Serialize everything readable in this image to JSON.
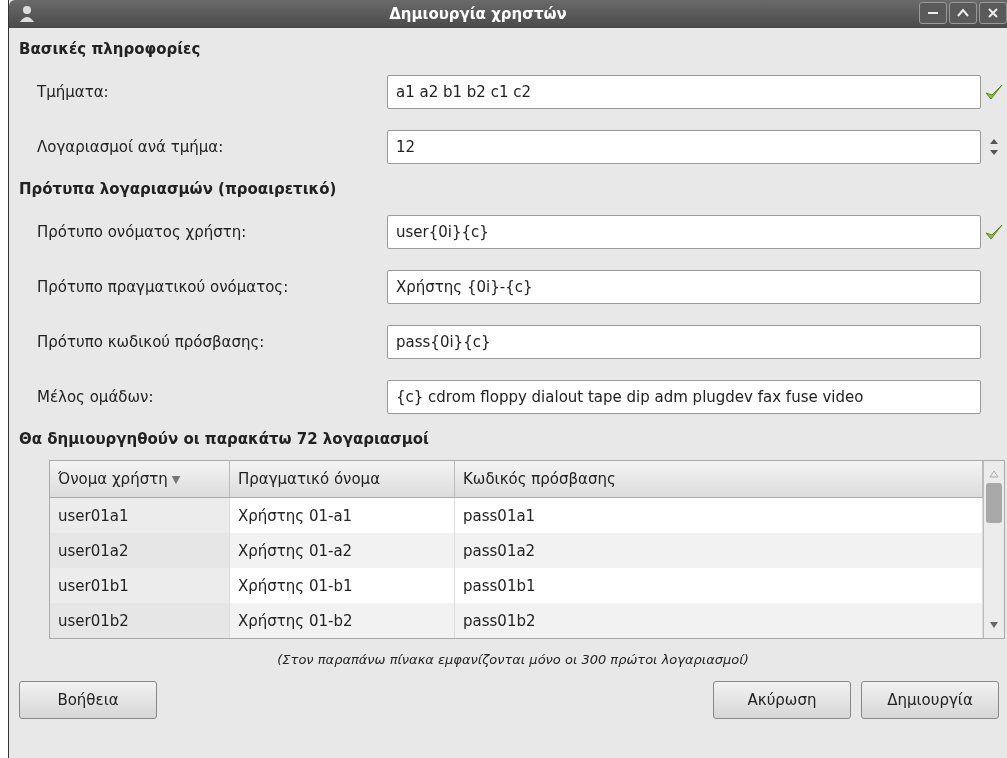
{
  "window": {
    "title": "Δημιουργία χρηστών"
  },
  "sections": [
    {
      "heading": "Βασικές πληροφορίες",
      "fields": [
        {
          "kind": "text",
          "label": "Τμήματα:",
          "value": "a1 a2 b1 b2 c1 c2",
          "valid": true
        },
        {
          "kind": "spin",
          "label": "Λογαριασμοί ανά τμήμα:",
          "value": "12"
        }
      ]
    },
    {
      "heading": "Πρότυπα λογαριασμών (προαιρετικό)",
      "fields": [
        {
          "kind": "text",
          "label": "Πρότυπο ονόματος χρήστη:",
          "value": "user{0i}{c}",
          "valid": true
        },
        {
          "kind": "text",
          "label": "Πρότυπο πραγματικού ονόματος:",
          "value": "Χρήστης {0i}-{c}",
          "valid": false
        },
        {
          "kind": "text",
          "label": "Πρότυπο κωδικού πρόσβασης:",
          "value": "pass{0i}{c}",
          "valid": false
        },
        {
          "kind": "text",
          "label": "Μέλος ομάδων:",
          "value": "{c} cdrom floppy dialout tape dip adm plugdev fax fuse video",
          "valid": false
        }
      ]
    }
  ],
  "table_heading": "Θα δημιουργηθούν οι παρακάτω 72 λογαριασμοί",
  "table": {
    "columns": [
      {
        "label": "Όνομα χρήστη",
        "sorted": true
      },
      {
        "label": "Πραγματικό όνομα",
        "sorted": false
      },
      {
        "label": "Κωδικός πρόσβασης",
        "sorted": false
      }
    ],
    "sort_indicator": "▼",
    "rows": [
      [
        "user01a1",
        "Χρήστης 01-a1",
        "pass01a1"
      ],
      [
        "user01a2",
        "Χρήστης 01-a2",
        "pass01a2"
      ],
      [
        "user01b1",
        "Χρήστης 01-b1",
        "pass01b1"
      ],
      [
        "user01b2",
        "Χρήστης 01-b2",
        "pass01b2"
      ]
    ]
  },
  "note": "(Στον παραπάνω πίνακα εμφανίζονται μόνο οι 300 πρώτοι λογαριασμοί)",
  "buttons": {
    "left": [
      "Βοήθεια"
    ],
    "right": [
      "Ακύρωση",
      "Δημιουργία"
    ]
  }
}
